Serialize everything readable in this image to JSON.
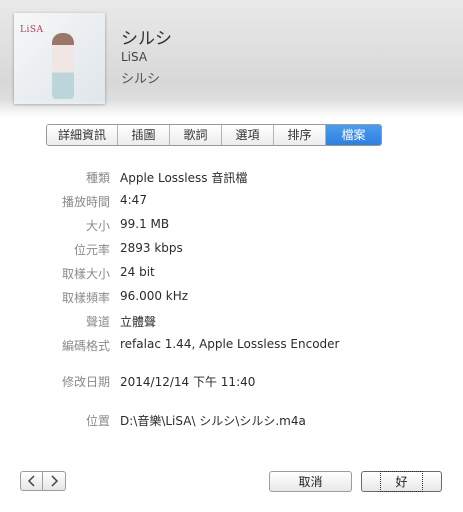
{
  "header": {
    "title": "シルシ",
    "artist": "LiSA",
    "album": "シルシ",
    "art_logo": "LiSA"
  },
  "tabs": [
    {
      "label": "詳細資訊",
      "active": false
    },
    {
      "label": "插圖",
      "active": false
    },
    {
      "label": "歌詞",
      "active": false
    },
    {
      "label": "選項",
      "active": false
    },
    {
      "label": "排序",
      "active": false
    },
    {
      "label": "檔案",
      "active": true
    }
  ],
  "fields": [
    {
      "label": "種類",
      "value": "Apple Lossless 音訊檔"
    },
    {
      "label": "播放時間",
      "value": "4:47"
    },
    {
      "label": "大小",
      "value": "99.1 MB"
    },
    {
      "label": "位元率",
      "value": "2893 kbps"
    },
    {
      "label": "取樣大小",
      "value": "24 bit"
    },
    {
      "label": "取樣頻率",
      "value": "96.000 kHz"
    },
    {
      "label": "聲道",
      "value": "立體聲"
    },
    {
      "label": "編碼格式",
      "value": "refalac 1.44, Apple Lossless Encoder"
    },
    {
      "label": "修改日期",
      "value": "2014/12/14 下午 11:40"
    },
    {
      "label": "位置",
      "value": "D:\\音樂\\LiSA\\ シルシ\\シルシ.m4a"
    }
  ],
  "buttons": {
    "cancel": "取消",
    "ok": "好"
  },
  "colors": {
    "accent": "#2f7fe0",
    "label": "#8a8a8a"
  }
}
